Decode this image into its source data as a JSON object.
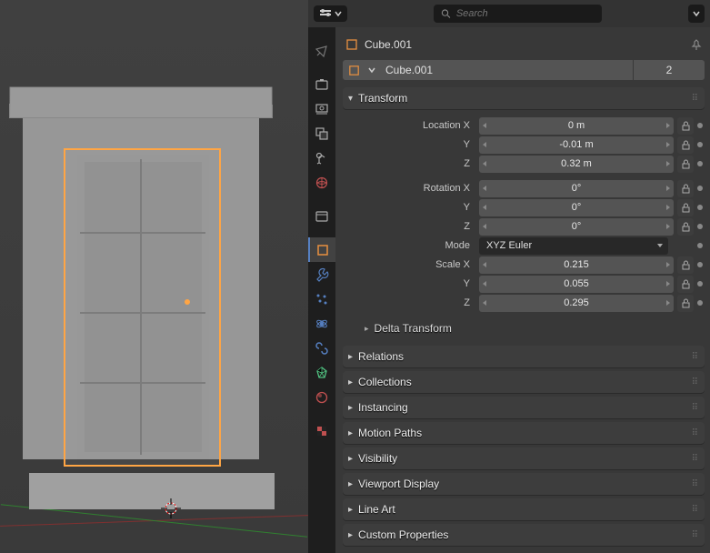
{
  "search": {
    "placeholder": "Search"
  },
  "object": {
    "name": "Cube.001",
    "data_name": "Cube.001",
    "users": "2"
  },
  "transform": {
    "title": "Transform",
    "location": {
      "label": "Location X",
      "x": "0 m",
      "y": "-0.01 m",
      "z": "0.32 m",
      "ylabel": "Y",
      "zlabel": "Z"
    },
    "rotation": {
      "label": "Rotation X",
      "x": "0°",
      "y": "0°",
      "z": "0°",
      "ylabel": "Y",
      "zlabel": "Z"
    },
    "mode": {
      "label": "Mode",
      "value": "XYZ Euler"
    },
    "scale": {
      "label": "Scale X",
      "x": "0.215",
      "y": "0.055",
      "z": "0.295",
      "ylabel": "Y",
      "zlabel": "Z"
    },
    "delta": "Delta Transform"
  },
  "sections": {
    "relations": "Relations",
    "collections": "Collections",
    "instancing": "Instancing",
    "motion_paths": "Motion Paths",
    "visibility": "Visibility",
    "viewport_display": "Viewport Display",
    "line_art": "Line Art",
    "custom_properties": "Custom Properties"
  },
  "tabs": [
    "render",
    "output",
    "view-layer",
    "scene",
    "world",
    "collection",
    "object",
    "modifiers",
    "particles",
    "physics",
    "constraints",
    "data",
    "material",
    "texture"
  ]
}
